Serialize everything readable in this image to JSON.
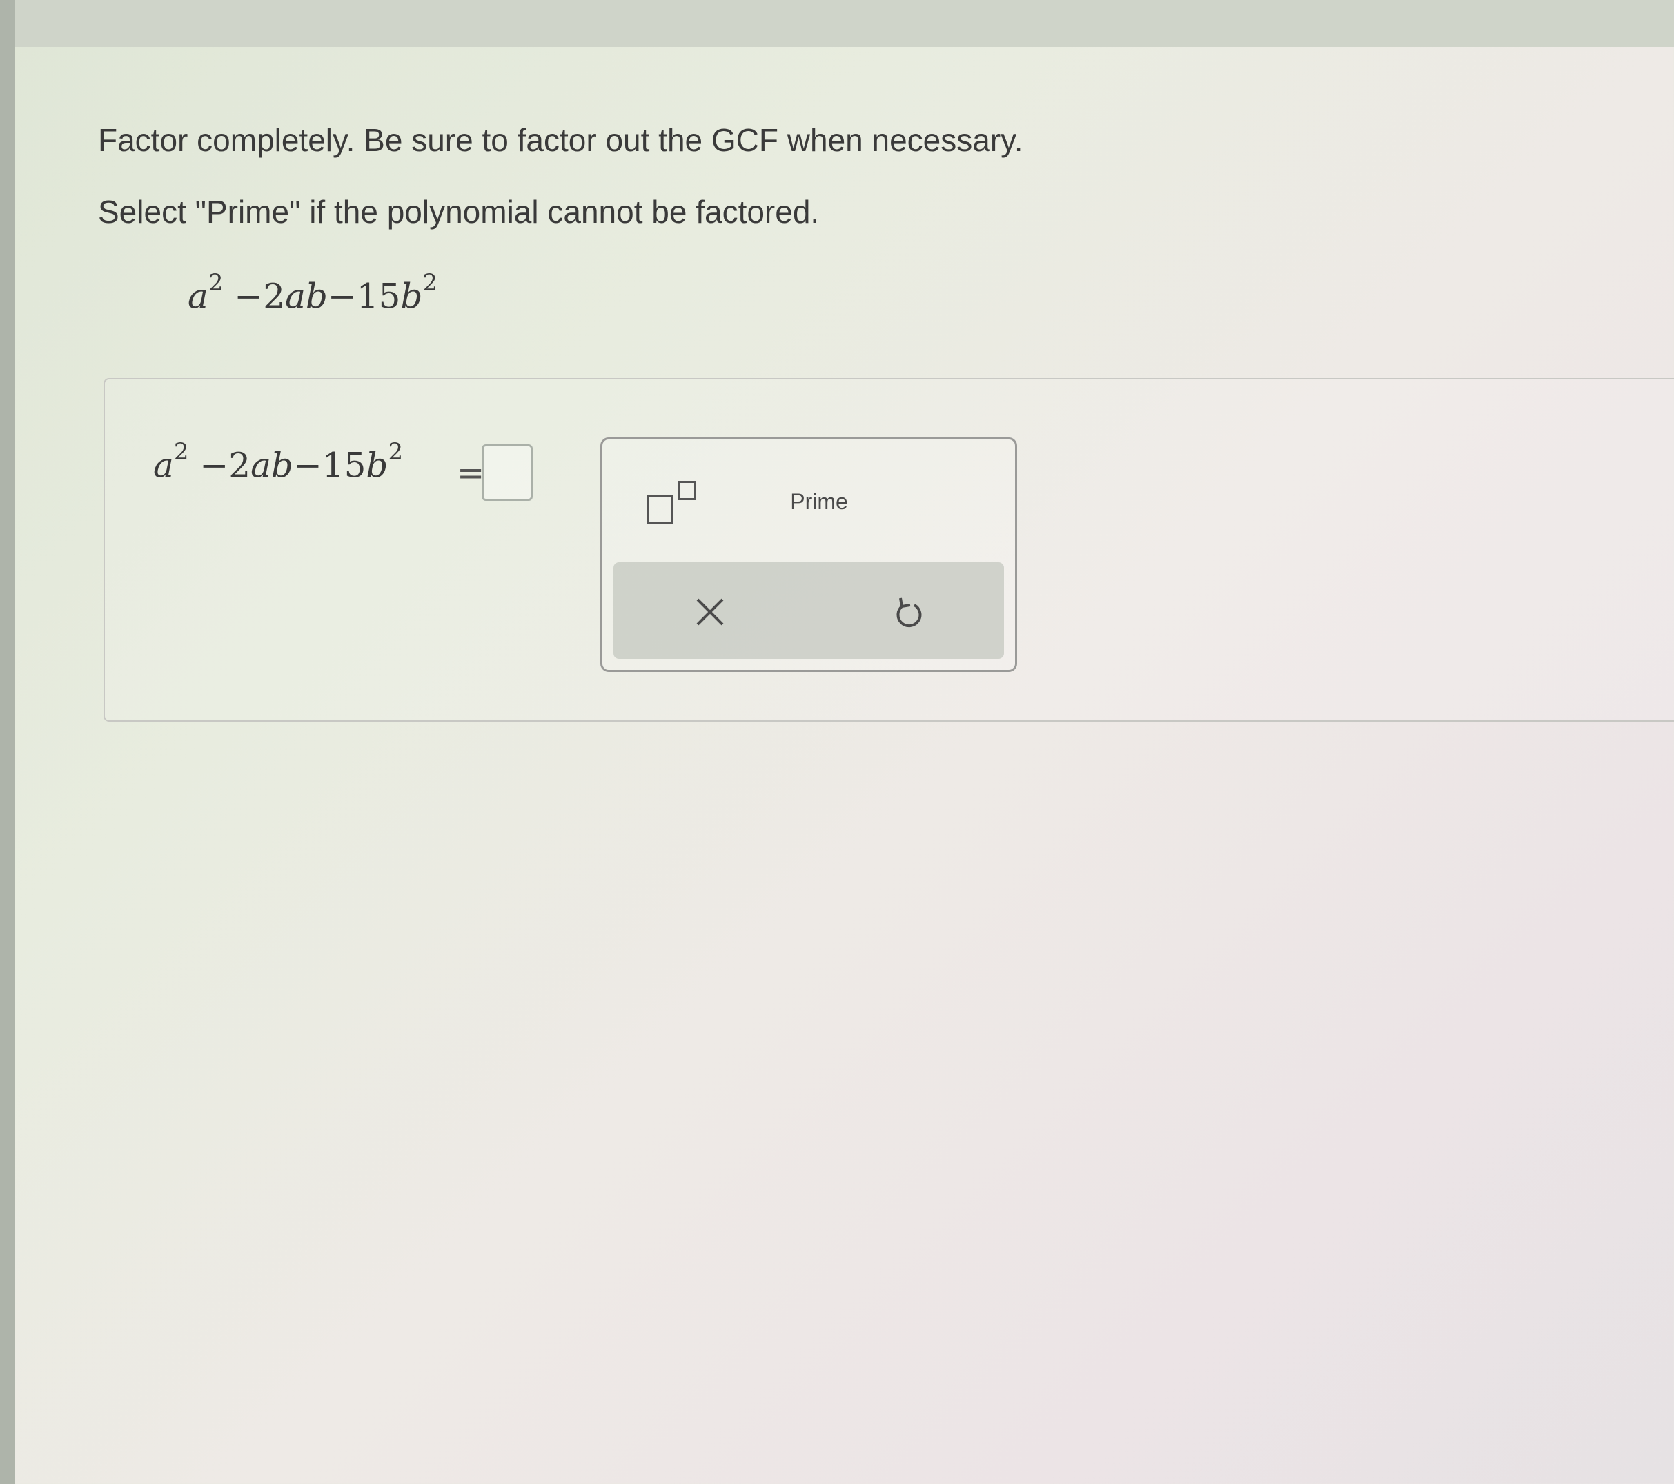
{
  "instructions": {
    "line1": "Factor completely. Be sure to factor out the GCF when necessary.",
    "line2": "Select \"Prime\" if the polynomial cannot be factored."
  },
  "problem": {
    "a": "a",
    "exp1": "2",
    "mid": " −2",
    "ab": "ab",
    "minus15": "−15",
    "b": "b",
    "exp2": "2"
  },
  "answer": {
    "a": "a",
    "exp1": "2",
    "mid": " −2",
    "ab": "ab",
    "minus15": "−15",
    "b": "b",
    "exp2": "2",
    "equals": "="
  },
  "toolbox": {
    "prime_label": "Prime",
    "icons": [
      "superscript-icon",
      "close-icon",
      "undo-icon"
    ]
  }
}
